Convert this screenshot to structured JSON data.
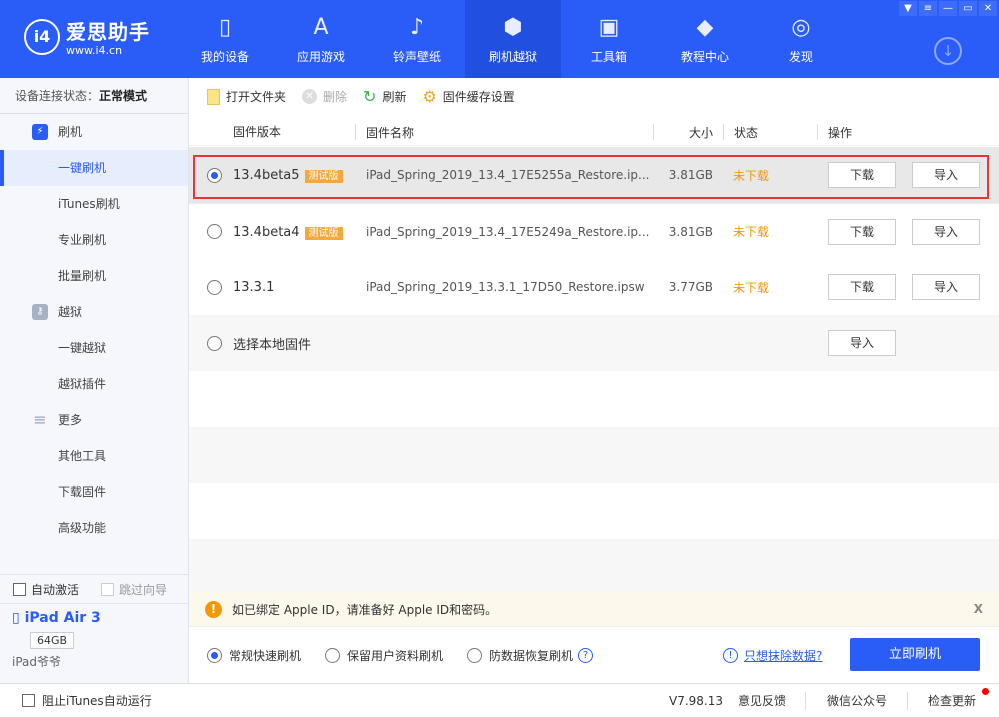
{
  "app": {
    "logo_mark": "i4",
    "title": "爱思助手",
    "url": "www.i4.cn"
  },
  "nav": [
    {
      "label": "我的设备",
      "icon": "▯"
    },
    {
      "label": "应用游戏",
      "icon": "A"
    },
    {
      "label": "铃声壁纸",
      "icon": "♪"
    },
    {
      "label": "刷机越狱",
      "icon": "⬢"
    },
    {
      "label": "工具箱",
      "icon": "▣"
    },
    {
      "label": "教程中心",
      "icon": "◆"
    },
    {
      "label": "发现",
      "icon": "◎"
    }
  ],
  "window": {
    "skin": "▼",
    "menu": "≡",
    "min": "—",
    "max": "▭",
    "close": "✕",
    "download": "↓"
  },
  "sidebar": {
    "status_label": "设备连接状态：",
    "status_value": "正常模式",
    "items": [
      {
        "label": "刷机",
        "group": true,
        "icon": "⚡"
      },
      {
        "label": "一键刷机"
      },
      {
        "label": "iTunes刷机"
      },
      {
        "label": "专业刷机"
      },
      {
        "label": "批量刷机"
      },
      {
        "label": "越狱",
        "group": true,
        "icon": "⚷"
      },
      {
        "label": "一键越狱"
      },
      {
        "label": "越狱插件"
      },
      {
        "label": "更多",
        "group": true,
        "icon": "≡"
      },
      {
        "label": "其他工具"
      },
      {
        "label": "下载固件"
      },
      {
        "label": "高级功能"
      }
    ],
    "auto_activate": "自动激活",
    "skip_guide": "跳过向导",
    "device": {
      "name": "iPad Air 3",
      "capacity": "64GB",
      "owner": "iPad爷爷"
    }
  },
  "toolbar": {
    "open_folder": "打开文件夹",
    "delete": "删除",
    "refresh": "刷新",
    "cache_settings": "固件缓存设置"
  },
  "table": {
    "headers": {
      "version": "固件版本",
      "name": "固件名称",
      "size": "大小",
      "status": "状态",
      "action": "操作"
    },
    "rows": [
      {
        "version": "13.4beta5",
        "badge": "测试版",
        "name": "iPad_Spring_2019_13.4_17E5255a_Restore.ip...",
        "size": "3.81GB",
        "status": "未下载",
        "download": "下载",
        "import": "导入",
        "selected": true
      },
      {
        "version": "13.4beta4",
        "badge": "测试版",
        "name": "iPad_Spring_2019_13.4_17E5249a_Restore.ip...",
        "size": "3.81GB",
        "status": "未下载",
        "download": "下载",
        "import": "导入"
      },
      {
        "version": "13.3.1",
        "badge": "",
        "name": "iPad_Spring_2019_13.3.1_17D50_Restore.ipsw",
        "size": "3.77GB",
        "status": "未下载",
        "download": "下载",
        "import": "导入"
      }
    ],
    "local": {
      "label": "选择本地固件",
      "import": "导入"
    }
  },
  "notice": {
    "text": "如已绑定 Apple ID，请准备好 Apple ID和密码。",
    "close": "X"
  },
  "options": {
    "normal": "常规快速刷机",
    "keep_data": "保留用户资料刷机",
    "anti_recovery": "防数据恢复刷机",
    "help": "?",
    "erase_link": "只想抹除数据?",
    "flash_button": "立即刷机"
  },
  "footer": {
    "block_itunes": "阻止iTunes自动运行",
    "version": "V7.98.13",
    "feedback": "意见反馈",
    "wechat": "微信公众号",
    "update": "检查更新"
  }
}
